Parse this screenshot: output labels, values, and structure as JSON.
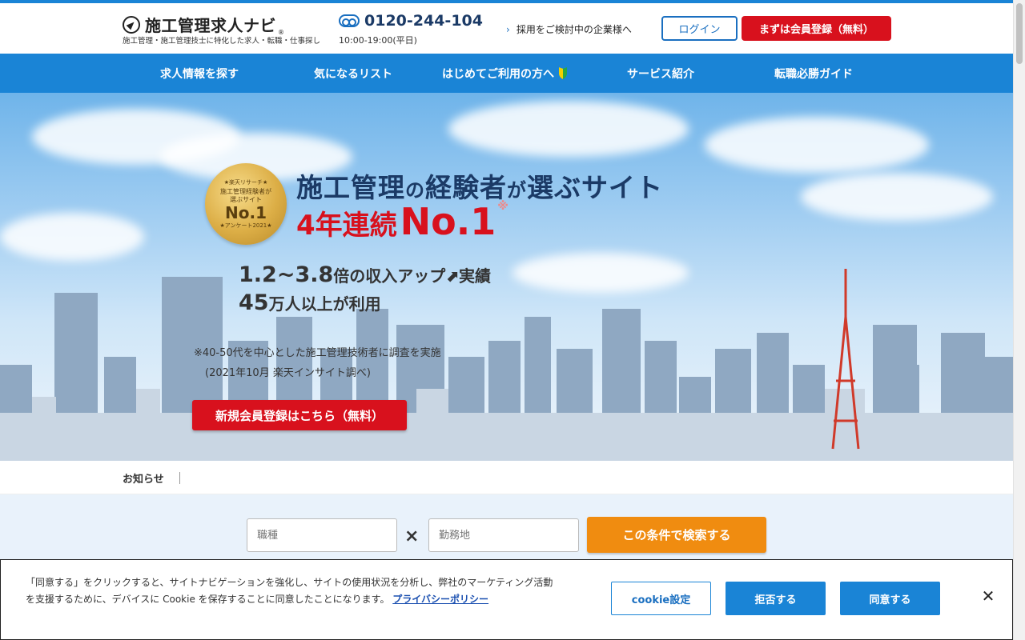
{
  "header": {
    "logo_text": "施工管理求人ナビ",
    "logo_reg": "®",
    "tagline": "施工管理・施工管理技士に特化した求人・転職・仕事探し",
    "phone_number": "0120-244-104",
    "phone_hours": "10:00-19:00(平日)",
    "corp_link": "採用をご検討中の企業様へ",
    "login_label": "ログイン",
    "register_label": "まずは会員登録（無料）"
  },
  "nav": {
    "items": [
      {
        "label": "求人情報を探す"
      },
      {
        "label": "気になるリスト"
      },
      {
        "label": "はじめてご利用の方へ"
      },
      {
        "label": "サービス紹介"
      },
      {
        "label": "転職必勝ガイド"
      }
    ]
  },
  "hero": {
    "badge_top": "★楽天リサーチ★",
    "badge_mid": "施工管理経験者が\n選ぶサイト",
    "badge_no1": "No.1",
    "badge_bottom": "★アンケート2021★",
    "title1_a": "施工管理",
    "title1_b": "の",
    "title1_c": "経験者",
    "title1_d": "が",
    "title1_e": "選ぶ",
    "title1_f": "サイト",
    "title2_a": "4年連続",
    "title2_b": "No.1",
    "title2_ast": "※",
    "stats1_big": "1.2~3.8",
    "stats1_rest": "倍の収入アップ⬈実績",
    "stats2_big": "45",
    "stats2_rest": "万人以上が利用",
    "note1": "※40-50代を中心とした施工管理技術者に調査を実施",
    "note2": "(2021年10月 楽天インサイト調べ)",
    "cta_label": "新規会員登録はこちら（無料）"
  },
  "news": {
    "label": "お知らせ"
  },
  "search": {
    "job_placeholder": "職種",
    "location_placeholder": "勤務地",
    "times": "×",
    "button_label": "この条件で検索する"
  },
  "cookie": {
    "text": "「同意する」をクリックすると、サイトナビゲーションを強化し、サイトの使用状況を分析し、弊社のマーケティング活動を支援するために、デバイスに Cookie を保存することに同意したことになります。",
    "privacy_link": "プライバシーポリシー",
    "settings_label": "cookie設定",
    "reject_label": "拒否する",
    "accept_label": "同意する",
    "close": "✕"
  }
}
